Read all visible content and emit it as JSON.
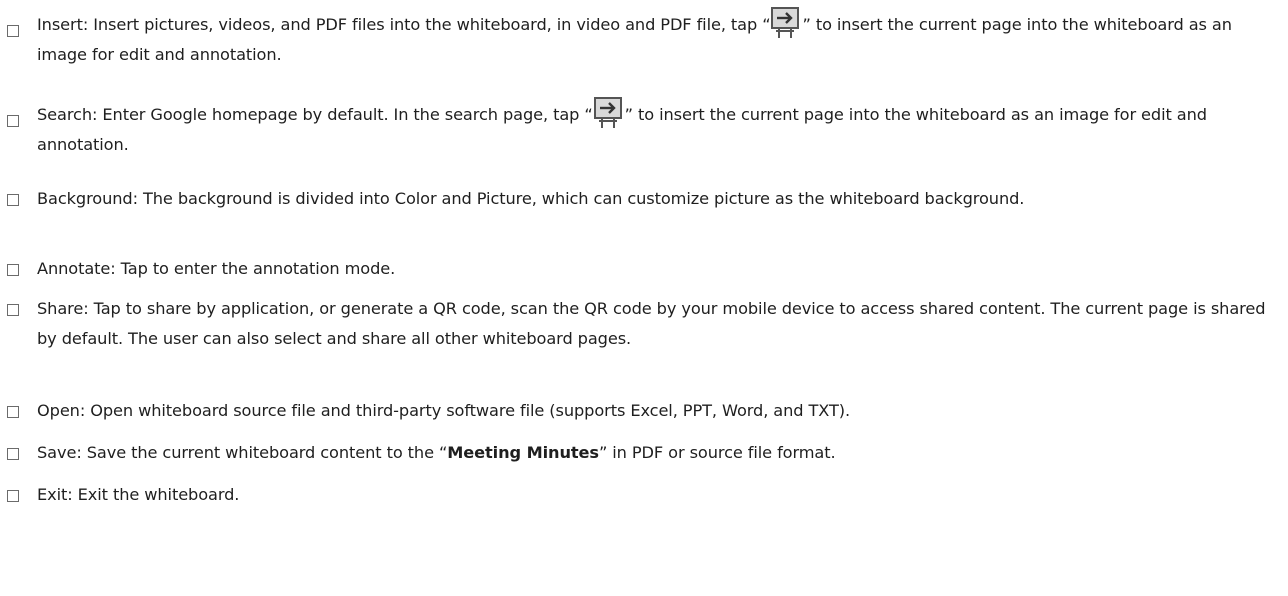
{
  "items": [
    {
      "before_icon": "Insert: Insert pictures, videos, and PDF files into the whiteboard, in video and PDF file, tap “",
      "icon": "insert-into-whiteboard-icon",
      "after_icon": "” to insert the current page into the whiteboard as an image for edit and annotation."
    },
    {
      "before_icon": "Search: Enter Google homepage by default. In the search page, tap “",
      "icon": "insert-into-whiteboard-icon",
      "after_icon": "” to insert the current page into the whiteboard as an image for edit and annotation."
    },
    {
      "text": "Background: The background is divided into Color and Picture, which can customize picture as the whiteboard background."
    },
    {
      "text": "Annotate: Tap to enter the annotation mode."
    },
    {
      "text": "Share: Tap to share by application, or generate a QR code, scan the QR code by your mobile device to access shared content. The current page is shared by default. The user can also select and share all other whiteboard pages."
    },
    {
      "text": "Open: Open whiteboard source file and third-party software file (supports Excel, PPT, Word, and TXT)."
    },
    {
      "before_bold": "Save: Save the current whiteboard content to the “",
      "bold": "Meeting Minutes",
      "after_bold": "” in PDF or source file format."
    },
    {
      "text": "Exit: Exit the whiteboard."
    }
  ]
}
